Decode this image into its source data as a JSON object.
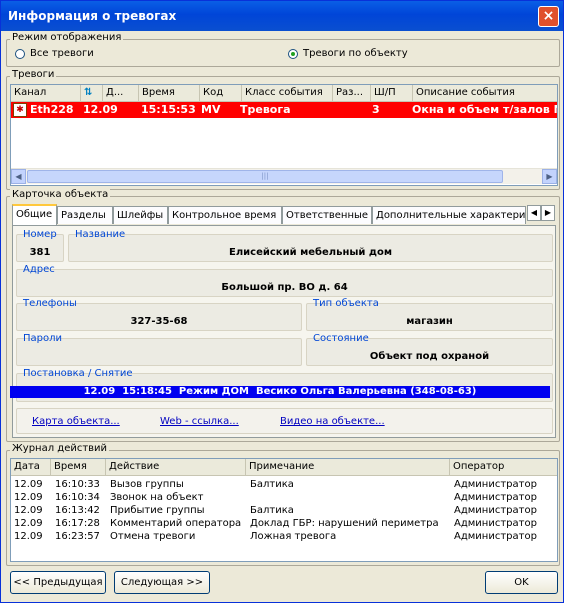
{
  "window": {
    "title": "Информация о тревогах",
    "close_symbol": "×"
  },
  "display_mode": {
    "label": "Режим отображения",
    "options": [
      {
        "label": "Все тревоги",
        "selected": false
      },
      {
        "label": "Тревоги по объекту",
        "selected": true
      }
    ]
  },
  "alarms": {
    "label": "Тревоги",
    "columns": [
      "Канал",
      "",
      "Д...",
      "Время",
      "Код",
      "Класс события",
      "Раз...",
      "Ш/П",
      "Описание события"
    ],
    "rows": [
      {
        "channel": "Eth228",
        "date": "12.09",
        "time": "15:15:53",
        "code": "MV",
        "event_class": "Тревога",
        "section": "",
        "loop": "3",
        "description": "Окна и объем т/залов N"
      }
    ]
  },
  "object_card": {
    "label": "Карточка объекта",
    "tabs": [
      "Общие",
      "Разделы",
      "Шлейфы",
      "Контрольное время",
      "Ответственные",
      "Дополнительные характеристики"
    ],
    "active_tab": "Общие",
    "fields": {
      "number": {
        "label": "Номер",
        "value": "381"
      },
      "name": {
        "label": "Название",
        "value": "Елисейский мебельный дом"
      },
      "address": {
        "label": "Адрес",
        "value": "Большой пр. ВО д. 64"
      },
      "phones": {
        "label": "Телефоны",
        "value": "327-35-68"
      },
      "object_type": {
        "label": "Тип объекта",
        "value": "магазин"
      },
      "passwords": {
        "label": "Пароли",
        "value": ""
      },
      "state": {
        "label": "Состояние",
        "value": "Объект под охраной"
      },
      "arming": {
        "label": "Постановка / Снятие",
        "value": "12.09  15:18:45  Режим ДОМ  Весико Ольга Валерьевна (348-08-63)"
      }
    },
    "links": [
      "Карта объекта...",
      "Web - ссылка...",
      "Видео на объекте..."
    ]
  },
  "journal": {
    "label": "Журнал действий",
    "columns": [
      "Дата",
      "Время",
      "Действие",
      "Примечание",
      "Оператор"
    ],
    "rows": [
      {
        "date": "12.09",
        "time": "16:10:33",
        "action": "Вызов группы",
        "note": "Балтика",
        "operator": "Администратор"
      },
      {
        "date": "12.09",
        "time": "16:10:34",
        "action": "Звонок на объект",
        "note": "",
        "operator": "Администратор"
      },
      {
        "date": "12.09",
        "time": "16:13:42",
        "action": "Прибытие группы",
        "note": "Балтика",
        "operator": "Администратор"
      },
      {
        "date": "12.09",
        "time": "16:17:28",
        "action": "Комментарий оператора",
        "note": "Доклад ГБР: нарушений периметра",
        "operator": "Администратор"
      },
      {
        "date": "12.09",
        "time": "16:23:57",
        "action": "Отмена тревоги",
        "note": "Ложная тревога",
        "operator": "Администратор"
      }
    ]
  },
  "buttons": {
    "prev": "<< Предыдущая",
    "next": "Следующая >>",
    "ok": "OK"
  },
  "colors": {
    "alarm_row": "#ff0000",
    "arming_bar": "#0000f0",
    "field_label": "#0046d5"
  }
}
